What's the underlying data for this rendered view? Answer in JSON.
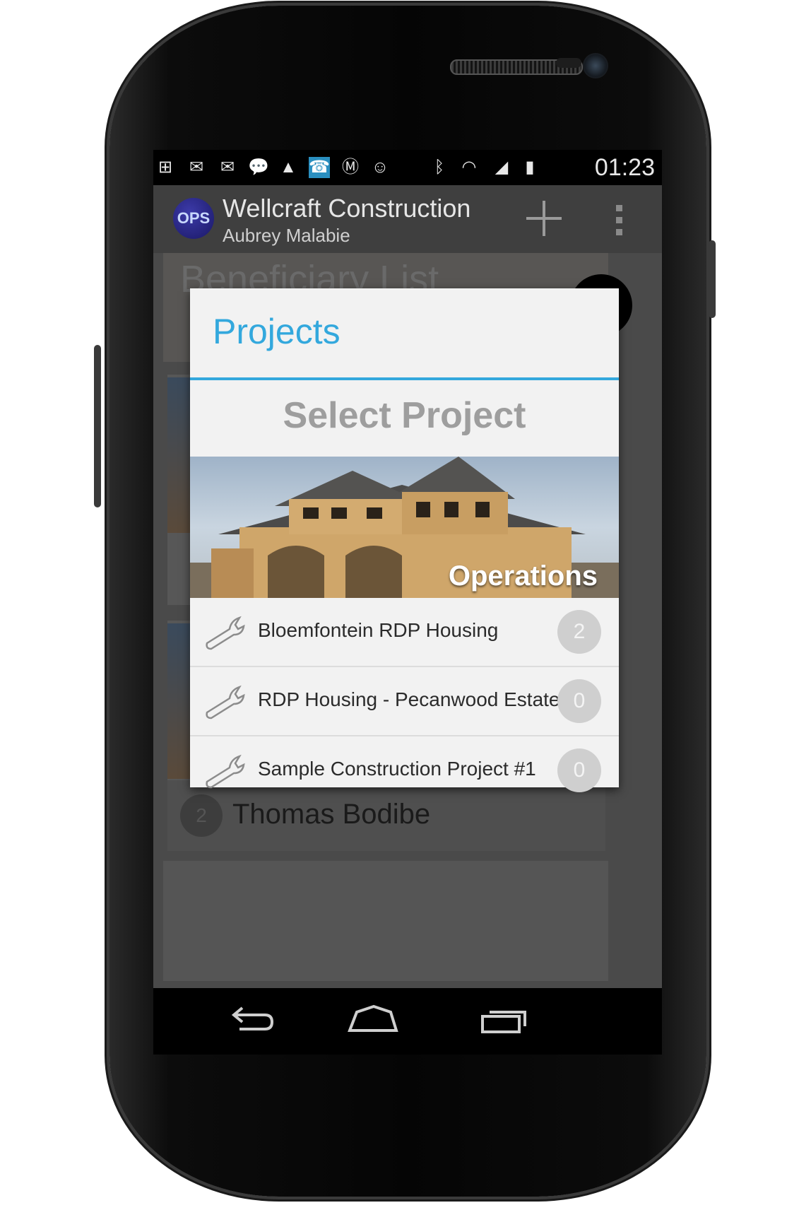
{
  "status_bar": {
    "icons": [
      "plus-box-icon",
      "gmail-icon",
      "gmail-icon",
      "chat-icon",
      "a-icon",
      "missed-call-icon",
      "motorola-icon",
      "messaging-icon",
      "bluetooth-icon",
      "wifi-icon",
      "signal-icon",
      "battery-icon"
    ],
    "time": "01:23"
  },
  "action_bar": {
    "logo_text": "OPS",
    "title": "Wellcraft Construction",
    "subtitle": "Aubrey Malabie"
  },
  "background": {
    "list_title": "Beneficiary List",
    "visible_item": {
      "badge": "2",
      "name": "Thomas Bodibe"
    }
  },
  "dialog": {
    "title": "Projects",
    "heading": "Select Project",
    "banner_label": "Operations",
    "projects": [
      {
        "name": "Bloemfontein RDP Housing",
        "count": "2"
      },
      {
        "name": "RDP Housing - Pecanwood Estate",
        "count": "0"
      },
      {
        "name": "Sample Construction Project #1",
        "count": "0"
      }
    ]
  },
  "colors": {
    "accent": "#33a8dd",
    "action_bar": "#3f3f3f",
    "dialog_bg": "#f2f2f2",
    "badge_bg": "#cfcfcf"
  }
}
